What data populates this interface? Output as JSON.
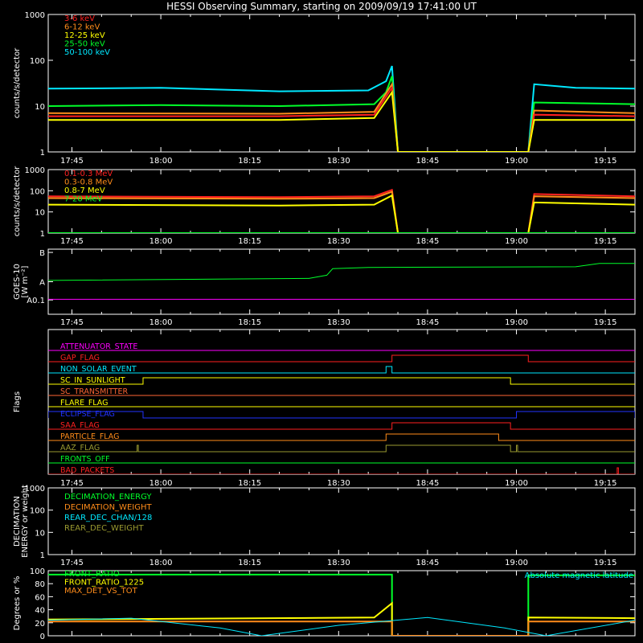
{
  "title": "HESSI Observing Summary, starting on 2009/09/19 17:41:00 UT",
  "time_ticks": [
    "17:45",
    "18:00",
    "18:15",
    "18:30",
    "18:45",
    "19:00",
    "19:15"
  ],
  "colors": {
    "background": "#000000",
    "axes": "#ffffff",
    "red": "#ff2020",
    "orange": "#ff8c1a",
    "yellow": "#ffff00",
    "green": "#00ff2a",
    "cyan": "#00e8ff",
    "magenta": "#ff00ff",
    "blue": "#2233ff",
    "olive": "#9a9a30",
    "sienna": "#ff6633"
  },
  "chart_data": [
    {
      "id": "xray-lo",
      "type": "line",
      "ylabel": "counts/s/detector",
      "yscale": "log",
      "ylim": [
        1,
        1000
      ],
      "ytick_labels": [
        "1",
        "10",
        "100",
        "1000"
      ],
      "legend": [
        {
          "name": "3-6 keV",
          "color": "#ff2020"
        },
        {
          "name": "6-12 keV",
          "color": "#ff8c1a"
        },
        {
          "name": "12-25 keV",
          "color": "#ffff00"
        },
        {
          "name": "25-50 keV",
          "color": "#00ff2a"
        },
        {
          "name": "50-100 keV",
          "color": "#00e8ff"
        }
      ],
      "series": [
        {
          "name": "50-100 keV",
          "color": "#00e8ff",
          "points": [
            [
              "17:41",
              24
            ],
            [
              "18:00",
              25
            ],
            [
              "18:20",
              21
            ],
            [
              "18:35",
              22
            ],
            [
              "18:38",
              35
            ],
            [
              "18:39",
              75
            ],
            [
              "18:40",
              1
            ],
            [
              "19:02",
              1
            ],
            [
              "19:03",
              30
            ],
            [
              "19:10",
              25
            ],
            [
              "19:20",
              24
            ]
          ]
        },
        {
          "name": "25-50 keV",
          "color": "#00ff2a",
          "points": [
            [
              "17:41",
              10
            ],
            [
              "18:00",
              10.5
            ],
            [
              "18:20",
              10
            ],
            [
              "18:36",
              11
            ],
            [
              "18:38",
              20
            ],
            [
              "18:39",
              45
            ],
            [
              "18:40",
              1
            ],
            [
              "19:02",
              1
            ],
            [
              "19:03",
              12
            ],
            [
              "19:20",
              11
            ]
          ]
        },
        {
          "name": "6-12 keV",
          "color": "#ff8c1a",
          "points": [
            [
              "17:41",
              7
            ],
            [
              "18:20",
              6.8
            ],
            [
              "18:36",
              7.5
            ],
            [
              "18:39",
              30
            ],
            [
              "18:40",
              1
            ],
            [
              "19:02",
              1
            ],
            [
              "19:03",
              8
            ],
            [
              "19:20",
              7
            ]
          ]
        },
        {
          "name": "3-6 keV",
          "color": "#ff2020",
          "points": [
            [
              "17:41",
              6
            ],
            [
              "18:20",
              6
            ],
            [
              "18:36",
              6.5
            ],
            [
              "18:39",
              25
            ],
            [
              "18:40",
              1
            ],
            [
              "19:02",
              1
            ],
            [
              "19:03",
              6.5
            ],
            [
              "19:20",
              6
            ]
          ]
        },
        {
          "name": "12-25 keV",
          "color": "#ffff00",
          "points": [
            [
              "17:41",
              5
            ],
            [
              "18:20",
              5
            ],
            [
              "18:36",
              5.5
            ],
            [
              "18:39",
              20
            ],
            [
              "18:40",
              1
            ],
            [
              "19:02",
              1
            ],
            [
              "19:03",
              5
            ],
            [
              "19:20",
              5
            ]
          ]
        }
      ]
    },
    {
      "id": "xray-hi",
      "type": "line",
      "ylabel": "counts/s/detector",
      "yscale": "log",
      "ylim": [
        1,
        1000
      ],
      "ytick_labels": [
        "1",
        "10",
        "100",
        "1000"
      ],
      "legend": [
        {
          "name": "0.1-0.3 MeV",
          "color": "#ff2020"
        },
        {
          "name": "0.3-0.8 MeV",
          "color": "#ff8c1a"
        },
        {
          "name": "0.8-7 MeV",
          "color": "#ffff00"
        },
        {
          "name": "7-20 MeV",
          "color": "#00ff2a"
        }
      ],
      "series": [
        {
          "name": "0.1-0.3 MeV",
          "color": "#ff2020",
          "points": [
            [
              "17:41",
              55
            ],
            [
              "18:20",
              50
            ],
            [
              "18:36",
              55
            ],
            [
              "18:39",
              110
            ],
            [
              "18:40",
              1
            ],
            [
              "19:02",
              1
            ],
            [
              "19:03",
              70
            ],
            [
              "19:20",
              55
            ]
          ]
        },
        {
          "name": "0.3-0.8 MeV",
          "color": "#ff8c1a",
          "points": [
            [
              "17:41",
              45
            ],
            [
              "18:20",
              42
            ],
            [
              "18:36",
              45
            ],
            [
              "18:39",
              90
            ],
            [
              "18:40",
              1
            ],
            [
              "19:02",
              1
            ],
            [
              "19:03",
              55
            ],
            [
              "19:20",
              45
            ]
          ]
        },
        {
          "name": "0.8-7 MeV",
          "color": "#ffff00",
          "points": [
            [
              "17:41",
              22
            ],
            [
              "18:20",
              20
            ],
            [
              "18:36",
              22
            ],
            [
              "18:39",
              60
            ],
            [
              "18:40",
              1
            ],
            [
              "19:02",
              1
            ],
            [
              "19:03",
              28
            ],
            [
              "19:20",
              22
            ]
          ]
        },
        {
          "name": "7-20 MeV",
          "color": "#00ff2a",
          "points": [
            [
              "17:41",
              1
            ],
            [
              "19:20",
              1
            ]
          ]
        }
      ]
    },
    {
      "id": "goes",
      "type": "line",
      "ylabel": "GOES-10",
      "ylabel2": "[W m⁻²]",
      "yscale": "log",
      "ytick_labels": [
        "A0.1",
        "A",
        "B"
      ],
      "series": [
        {
          "name": "long",
          "color": "#00ff2a",
          "points": [
            [
              "17:41",
              0.52
            ],
            [
              "18:25",
              0.55
            ],
            [
              "18:28",
              0.6
            ],
            [
              "18:29",
              0.7
            ],
            [
              "18:35",
              0.72
            ],
            [
              "19:10",
              0.73
            ],
            [
              "19:14",
              0.78
            ],
            [
              "19:20",
              0.78
            ]
          ]
        },
        {
          "name": "short",
          "color": "#ff00ff",
          "points": [
            [
              "17:41",
              0.23
            ],
            [
              "19:20",
              0.23
            ]
          ]
        }
      ]
    },
    {
      "id": "flags",
      "type": "line",
      "ylabel": "Flags",
      "rows": [
        {
          "name": "ATTENUATOR_STATE",
          "color": "#ff00ff",
          "high": []
        },
        {
          "name": "GAP_FLAG",
          "color": "#ff2020",
          "high": [
            [
              "18:39",
              "19:02"
            ]
          ]
        },
        {
          "name": "NON_SOLAR_EVENT",
          "color": "#00e8ff",
          "high": [
            [
              "18:38",
              "18:39"
            ]
          ]
        },
        {
          "name": "SC_IN_SUNLIGHT",
          "color": "#ffff00",
          "high": [
            [
              "17:57",
              "18:59"
            ]
          ]
        },
        {
          "name": "SC_TRANSMITTER",
          "color": "#ff6633",
          "high": []
        },
        {
          "name": "FLARE_FLAG",
          "color": "#ffff00",
          "high": []
        },
        {
          "name": "ECLIPSE_FLAG",
          "color": "#2233ff",
          "high": [
            [
              "17:41",
              "17:57"
            ],
            [
              "19:00",
              "19:20"
            ]
          ]
        },
        {
          "name": "SAA_FLAG",
          "color": "#ff2020",
          "high": [
            [
              "18:39",
              "18:59"
            ]
          ]
        },
        {
          "name": "PARTICLE_FLAG",
          "color": "#ff8c1a",
          "high": [
            [
              "18:38",
              "18:57"
            ]
          ]
        },
        {
          "name": "AAZ_FLAG",
          "color": "#9a9a30",
          "high": [
            [
              "17:56",
              "17:56"
            ],
            [
              "18:38",
              "18:59"
            ],
            [
              "19:00",
              "19:00"
            ]
          ]
        },
        {
          "name": "FRONTS_OFF",
          "color": "#00ff2a",
          "high": []
        },
        {
          "name": "BAD_PACKETS",
          "color": "#ff2020",
          "high": [
            [
              "19:17",
              "19:17"
            ]
          ]
        }
      ]
    },
    {
      "id": "decimation",
      "type": "line",
      "ylabel": "DECIMATION",
      "ylabel2": "ENERGY or weight",
      "yscale": "log",
      "ylim": [
        1,
        1000
      ],
      "ytick_labels": [
        "1",
        "10",
        "100",
        "1000"
      ],
      "legend": [
        {
          "name": "DECIMATION_ENERGY",
          "color": "#00ff2a"
        },
        {
          "name": "DECIMATION_WEIGHT",
          "color": "#ff8c1a"
        },
        {
          "name": "REAR_DEC_CHAN/128",
          "color": "#00e8ff"
        },
        {
          "name": "REAR_DEC_WEIGHT",
          "color": "#9a9a30"
        }
      ],
      "series": []
    },
    {
      "id": "ratio",
      "type": "line",
      "ylabel": "Degrees or %",
      "ylim": [
        0,
        100
      ],
      "ytick_labels": [
        "0",
        "20",
        "40",
        "60",
        "80",
        "100"
      ],
      "legend": [
        {
          "name": "FRONT_RATIO",
          "color": "#00ff2a"
        },
        {
          "name": "FRONT_RATIO_1225",
          "color": "#ffff00"
        },
        {
          "name": "MAX_DET_VS_TOT",
          "color": "#ff8c1a"
        }
      ],
      "right_label": "Absolute magnetic latitude",
      "series": [
        {
          "name": "FRONT_RATIO",
          "color": "#00ff2a",
          "points": [
            [
              "17:41",
              94
            ],
            [
              "18:39",
              94
            ],
            [
              "18:39",
              0
            ],
            [
              "19:02",
              0
            ],
            [
              "19:02",
              93
            ],
            [
              "19:20",
              93
            ]
          ]
        },
        {
          "name": "FRONT_RATIO_1225",
          "color": "#ffff00",
          "points": [
            [
              "17:41",
              25
            ],
            [
              "18:36",
              28
            ],
            [
              "18:39",
              50
            ],
            [
              "18:39",
              0
            ],
            [
              "19:02",
              0
            ],
            [
              "19:02",
              28
            ],
            [
              "19:20",
              27
            ]
          ]
        },
        {
          "name": "MAX_DET_VS_TOT",
          "color": "#ff8c1a",
          "points": [
            [
              "17:41",
              22
            ],
            [
              "18:39",
              22
            ],
            [
              "18:39",
              0
            ],
            [
              "19:02",
              0
            ],
            [
              "19:02",
              22
            ],
            [
              "19:20",
              22
            ]
          ]
        },
        {
          "name": "Absolute magnetic latitude",
          "color": "#00e8ff",
          "points": [
            [
              "17:41",
              24
            ],
            [
              "17:55",
              27
            ],
            [
              "18:10",
              12
            ],
            [
              "18:17",
              0
            ],
            [
              "18:30",
              16
            ],
            [
              "18:45",
              28
            ],
            [
              "18:58",
              12
            ],
            [
              "19:05",
              0
            ],
            [
              "19:20",
              24
            ]
          ]
        }
      ]
    }
  ]
}
